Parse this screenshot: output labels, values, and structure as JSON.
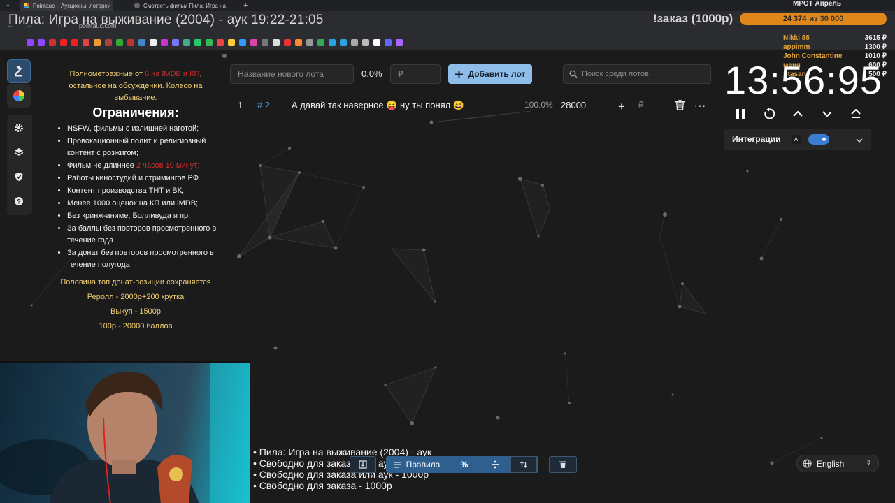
{
  "browser": {
    "tabs": [
      {
        "title": "Pointauc – Аукционы, лотереи",
        "active": true
      },
      {
        "title": "Смотреть фильм Пила: Игра на",
        "active": false
      }
    ],
    "url": "pointauc.com"
  },
  "stream_title": "Пила: Игра на выживание (2004) - аук 19:22-21:05",
  "overlay": {
    "order_label": "!заказ (1000р)",
    "mrot": {
      "title": "МРОТ Апрель",
      "current": "24 374",
      "goal_text": "из 30 000"
    },
    "donors": [
      {
        "name": "Nikki 88",
        "amount": "3615 ₽"
      },
      {
        "name": "appimm",
        "amount": "1300 ₽"
      },
      {
        "name": "John Constantine",
        "amount": "1010 ₽"
      },
      {
        "name": "меня",
        "amount": "600 ₽"
      },
      {
        "name": "Stasan",
        "amount": "500 ₽"
      }
    ]
  },
  "rules": {
    "intro_1": "Полнометражные от ",
    "intro_red": "6 на IMDB и КП",
    "intro_2": ", остальное на обсуждении. Колесо на выбывание.",
    "title": "Ограничения:",
    "items": [
      "NSFW, фильмы с излишней наготой;",
      "Провокационный полит и религиозный контент с розжигом;",
      "Фильм не длиннее ",
      "Работы киностудий и стримингов РФ",
      "Контент производства ТНТ и ВК;",
      "Менее 1000 оценок на КП или iMDB;",
      "Без кринж-аниме, Болливуда и пр.",
      "За баллы без повторов просмотренного в течение года",
      "За донат без повторов просмотренного в течение полугода"
    ],
    "duration_red": "2 часов 10 минут;",
    "footer": [
      "Половина топ донат-позиции сохраняется",
      "Реролл - 2000р+200 крутка",
      "Выкуп - 1500р",
      "100р - 20000 баллов"
    ]
  },
  "lot_form": {
    "name_placeholder": "Название нового лота",
    "percent": "0.0%",
    "amount_placeholder": "₽",
    "add_label": "Добавить лот",
    "search_placeholder": "Поиск среди лотов..."
  },
  "lots": [
    {
      "index": "1",
      "id": "# 2",
      "name": "А давай так наверное 😝 ну ты понял 😄",
      "percent": "100.0%",
      "amount": "28000",
      "currency": "₽"
    }
  ],
  "timer": {
    "value": "13:56:95"
  },
  "integrations": {
    "label": "Интеграции",
    "badge": "A",
    "enabled": true
  },
  "bottom_toolbar": {
    "rules_label": "Правила",
    "percent_label": "%"
  },
  "ticker": [
    "• Пила: Игра на выживание (2004) - аук",
    "• Свободно для заказа или аук - 1000р",
    "• Свободно для заказа или аук - 1000р",
    "• Свободно для заказа - 1000р"
  ],
  "language": {
    "selected": "English"
  },
  "colors": {
    "accent": "#8fbde9",
    "mrot_bar": "#e0871b",
    "rules_yellow": "#f2cf72",
    "rules_red": "#cc2e2e",
    "lot_id": "#4f8fd0",
    "toggle": "#3b7dd2"
  }
}
